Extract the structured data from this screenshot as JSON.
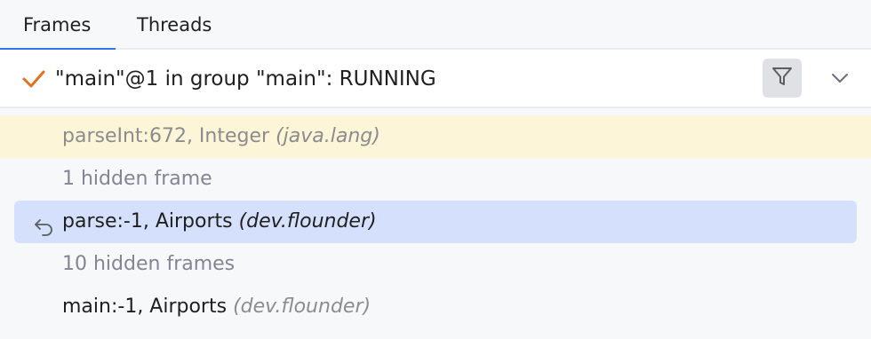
{
  "tabs": [
    {
      "label": "Frames",
      "active": true
    },
    {
      "label": "Threads",
      "active": false
    }
  ],
  "thread": {
    "status_icon": "check-icon",
    "label": "\"main\"@1 in group \"main\": RUNNING",
    "filter_icon": "filter-icon",
    "dropdown_icon": "chevron-down-icon"
  },
  "frames": [
    {
      "method": "parseInt:672, Integer",
      "package": "(java.lang)",
      "kind": "highlighted"
    },
    {
      "text": "1 hidden frame",
      "kind": "hidden"
    },
    {
      "method": "parse:-1, Airports",
      "package": "(dev.flounder)",
      "kind": "selected",
      "icon": "drop-frame-icon"
    },
    {
      "text": "10 hidden frames",
      "kind": "hidden"
    },
    {
      "method": "main:-1, Airports",
      "package": "(dev.flounder)",
      "kind": "normal"
    }
  ],
  "colors": {
    "accent": "#3574f0",
    "check": "#e2711d",
    "highlight_row": "#fdf5d8",
    "selected_row": "#d5e1fc"
  }
}
